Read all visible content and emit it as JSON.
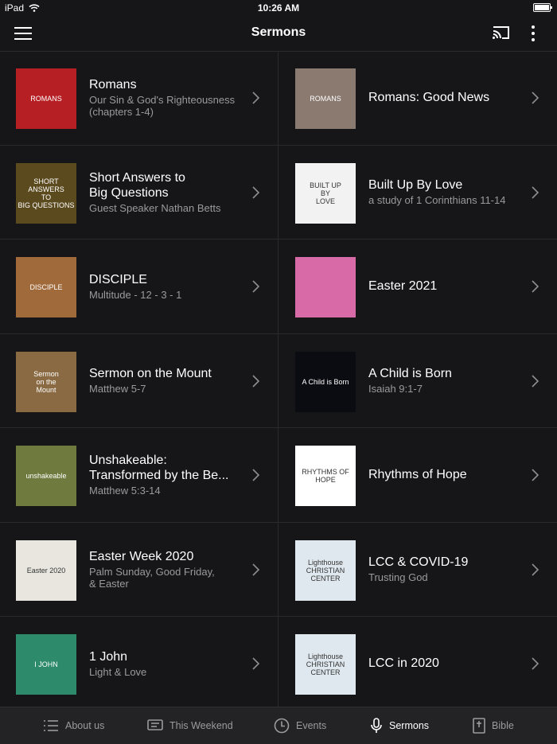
{
  "status": {
    "device": "iPad",
    "time": "10:26 AM"
  },
  "nav": {
    "title": "Sermons"
  },
  "sermons": [
    {
      "title": "Romans",
      "subtitle": "Our Sin & God's Righteousness\n(chapters 1-4)",
      "thumb_text": "ROMANS",
      "thumb_bg": "#b61f24"
    },
    {
      "title": "Romans: Good News",
      "subtitle": "",
      "thumb_text": "ROMANS",
      "thumb_bg": "#8a7a70"
    },
    {
      "title": "Short Answers to\nBig Questions",
      "subtitle": "Guest Speaker Nathan Betts",
      "thumb_text": "SHORT ANSWERS\nTO\nBIG QUESTIONS",
      "thumb_bg": "#5b4a1e"
    },
    {
      "title": "Built Up By Love",
      "subtitle": "a study of 1 Corinthians 11-14",
      "thumb_text": "BUILT UP\nBY\nLOVE",
      "thumb_bg": "#f2f2f2"
    },
    {
      "title": "DISCIPLE",
      "subtitle": "Multitude - 12 - 3 - 1",
      "thumb_text": "DISCIPLE",
      "thumb_bg": "#a06a3a"
    },
    {
      "title": "Easter 2021",
      "subtitle": "",
      "thumb_text": "",
      "thumb_bg": "#d96aa8"
    },
    {
      "title": "Sermon on the Mount",
      "subtitle": "Matthew 5-7",
      "thumb_text": "Sermon\non the\nMount",
      "thumb_bg": "#8a6a42"
    },
    {
      "title": "A Child is Born",
      "subtitle": "Isaiah 9:1-7",
      "thumb_text": "A Child is Born",
      "thumb_bg": "#0b0b12"
    },
    {
      "title": "Unshakeable:\nTransformed by the Be...",
      "subtitle": "Matthew 5:3-14",
      "thumb_text": "unshakeable",
      "thumb_bg": "#6e7a3e"
    },
    {
      "title": "Rhythms of Hope",
      "subtitle": "",
      "thumb_text": "RHYTHMS OF\nHOPE",
      "thumb_bg": "#ffffff"
    },
    {
      "title": "Easter Week 2020",
      "subtitle": "Palm Sunday, Good Friday,\n& Easter",
      "thumb_text": "Easter 2020",
      "thumb_bg": "#e8e6df"
    },
    {
      "title": "LCC & COVID-19",
      "subtitle": "Trusting God",
      "thumb_text": "Lighthouse\nCHRISTIAN CENTER",
      "thumb_bg": "#dfe8ee"
    },
    {
      "title": "1 John",
      "subtitle": "Light & Love",
      "thumb_text": "I JOHN",
      "thumb_bg": "#2d8a6a"
    },
    {
      "title": "LCC in 2020",
      "subtitle": "",
      "thumb_text": "Lighthouse\nCHRISTIAN CENTER",
      "thumb_bg": "#dfe8ee"
    }
  ],
  "tabs": [
    {
      "label": "About us",
      "icon": "list-icon",
      "active": false
    },
    {
      "label": "This Weekend",
      "icon": "message-icon",
      "active": false
    },
    {
      "label": "Events",
      "icon": "clock-icon",
      "active": false
    },
    {
      "label": "Sermons",
      "icon": "microphone-icon",
      "active": true
    },
    {
      "label": "Bible",
      "icon": "bible-icon",
      "active": false
    }
  ]
}
